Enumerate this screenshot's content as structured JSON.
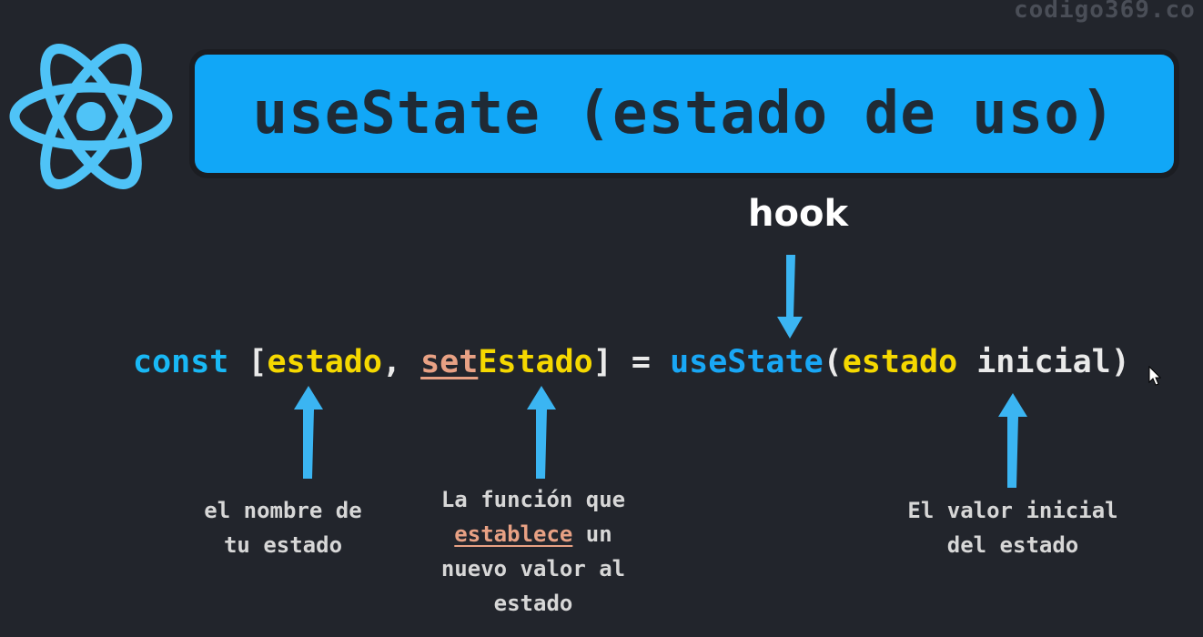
{
  "watermark": "codigo369.co",
  "title": "useState (estado de uso)",
  "hook_label": "hook",
  "code": {
    "const": "const",
    "open_bracket": " [",
    "state_var": "estado",
    "comma": ", ",
    "setter_prefix": "set",
    "setter_suffix": "Estado",
    "close_assign": "] = ",
    "hook_fn": "useState",
    "open_paren": "(",
    "initial_a": "estado",
    "initial_b": " inicial",
    "close_paren": ")"
  },
  "notes": {
    "state_name": {
      "line1": "el nombre de",
      "line2": "tu estado"
    },
    "setter": {
      "line1_a": "La función que",
      "line2_hl": "establece",
      "line2_b": " un",
      "line3": "nuevo valor al",
      "line4": "estado"
    },
    "initial": {
      "line1": "El valor inicial",
      "line2": "del estado"
    }
  },
  "colors": {
    "background": "#22252c",
    "banner": "#11a7f7",
    "react_logo": "#4fc3f7",
    "keyword": "#19b8f5",
    "variable": "#f5d800",
    "setter_highlight": "#e8a184",
    "arrow": "#3bb5f2"
  },
  "icons": {
    "logo": "react-atom-icon",
    "cursor": "mouse-cursor-icon"
  }
}
